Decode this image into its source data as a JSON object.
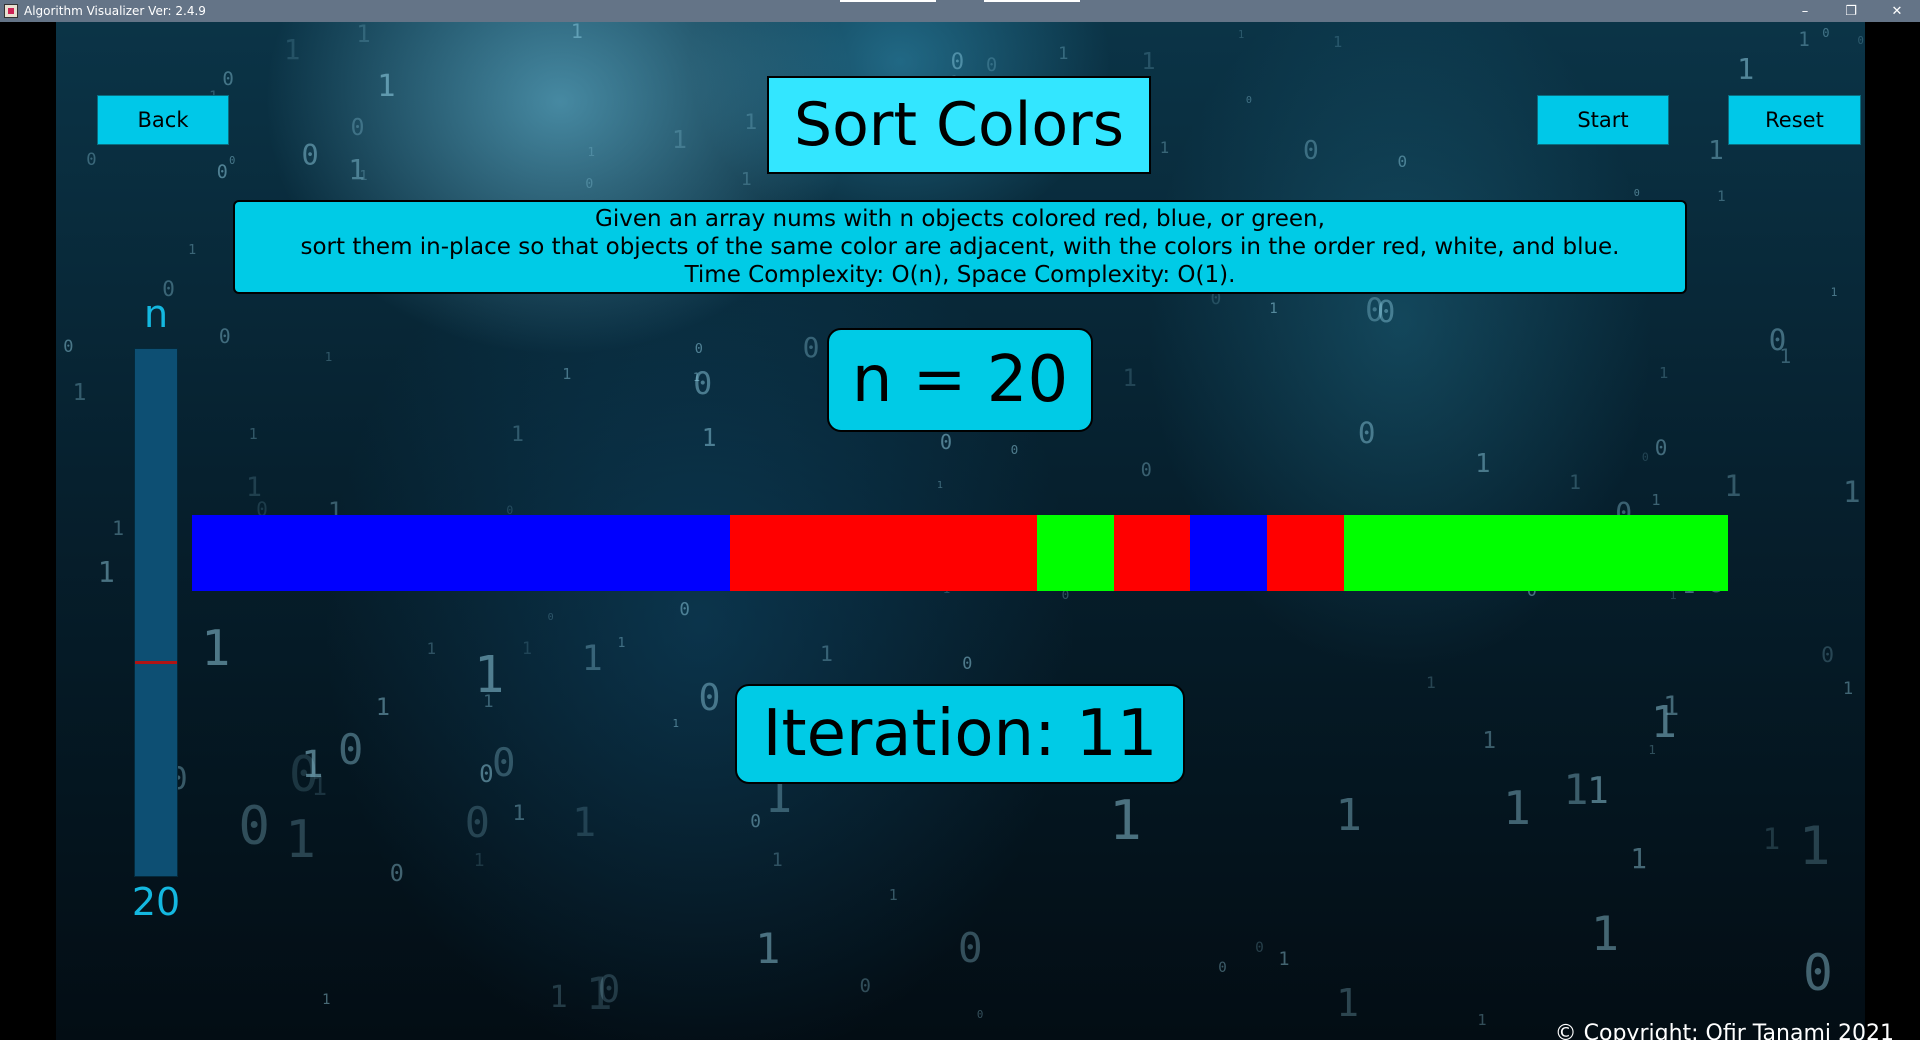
{
  "window": {
    "title": "Algorithm Visualizer Ver: 2.4.9",
    "controls": {
      "minimize": "–",
      "maximize": "❐",
      "close": "✕"
    }
  },
  "toolbar": {
    "back_label": "Back",
    "start_label": "Start",
    "reset_label": "Reset"
  },
  "page": {
    "title": "Sort Colors",
    "description": [
      "Given an array nums with n objects colored red, blue, or green,",
      "sort them in-place so that objects of the same color are adjacent, with the colors in the order red, white, and blue.",
      "Time Complexity: O(n), Space Complexity: O(1)."
    ],
    "n_display": "n = 20",
    "iteration_display": "Iteration: 11",
    "copyright": "© Copyright: Ofir Tanami 2021"
  },
  "slider": {
    "label": "n",
    "value": "20",
    "fill_fraction": 0.41
  },
  "array": {
    "cells": [
      "blue",
      "blue",
      "blue",
      "blue",
      "blue",
      "blue",
      "blue",
      "red",
      "red",
      "red",
      "red",
      "green",
      "red",
      "blue",
      "red",
      "green",
      "green",
      "green",
      "green",
      "green"
    ],
    "colors": {
      "blue": "#0000ff",
      "red": "#ff0000",
      "green": "#00ff00"
    }
  },
  "colors": {
    "accent": "#00cbe6",
    "title_bg": "#33e6ff",
    "slider_text": "#14b8e0",
    "titlebar": "#647487"
  }
}
